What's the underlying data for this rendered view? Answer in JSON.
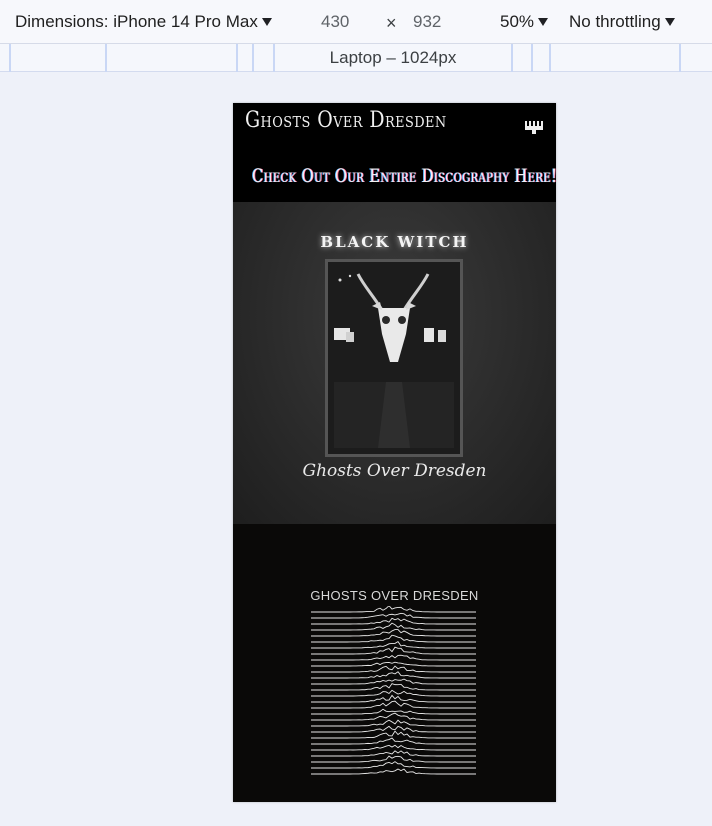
{
  "devtools": {
    "dimensions_label": "Dimensions: iPhone 14 Pro Max",
    "width": "430",
    "times": "×",
    "height": "932",
    "zoom": "50%",
    "throttling": "No throttling",
    "media_query_label": "Laptop – 1024px"
  },
  "site": {
    "logo": "Ghosts Over Dresden",
    "menu_icon": "menu-candelabra-icon",
    "banner": "Check Out Our Entire Discography Here!"
  },
  "albums": [
    {
      "title": "BLACK WITCH",
      "signature": "Ghosts Over Dresden"
    },
    {
      "title": "GHOSTS OVER DRESDEN"
    }
  ]
}
